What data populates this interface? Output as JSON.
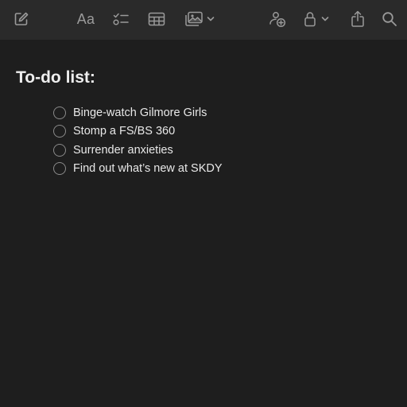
{
  "toolbar": {
    "items": [
      {
        "name": "compose-icon",
        "kind": "icon"
      },
      {
        "name": "format-text-button",
        "kind": "text",
        "label": "Aa"
      },
      {
        "name": "checklist-icon",
        "kind": "icon"
      },
      {
        "name": "table-icon",
        "kind": "icon"
      },
      {
        "name": "media-icon",
        "kind": "icon"
      },
      {
        "name": "collaborate-icon",
        "kind": "icon"
      },
      {
        "name": "lock-icon",
        "kind": "icon"
      },
      {
        "name": "share-icon",
        "kind": "icon"
      },
      {
        "name": "search-icon",
        "kind": "icon"
      }
    ]
  },
  "note": {
    "title": "To-do list:",
    "checklist": [
      {
        "label": "Binge-watch Gilmore Girls",
        "checked": false
      },
      {
        "label": "Stomp a FS/BS 360",
        "checked": false
      },
      {
        "label": "Surrender anxieties",
        "checked": false
      },
      {
        "label": "Find out what’s new at SKDY",
        "checked": false
      }
    ]
  },
  "colors": {
    "background": "#1e1e1e",
    "toolbar": "#2a2a2a",
    "icon": "#9a9a9a",
    "text": "#e8e8e8"
  }
}
